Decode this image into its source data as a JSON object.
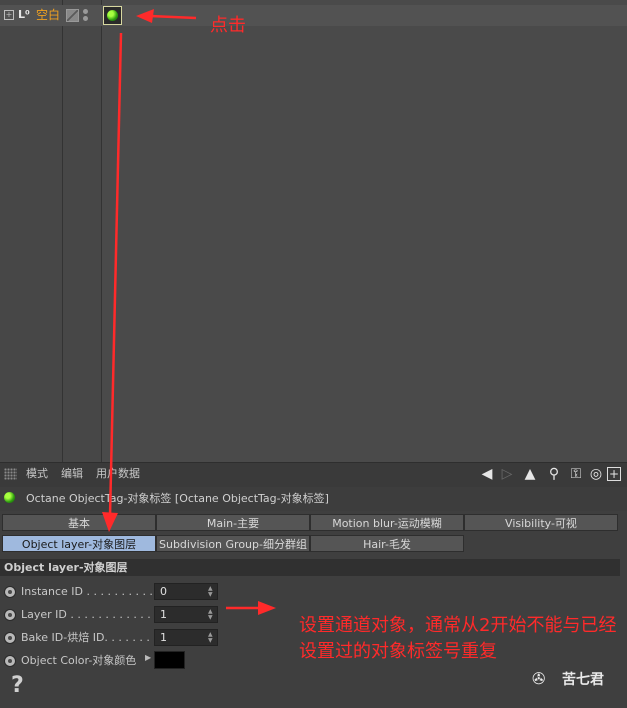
{
  "object_manager": {
    "object_name": "空白",
    "null_icon": "L⁰",
    "tag_icon": "octane-object-tag-icon"
  },
  "attribute_manager": {
    "menu": {
      "mode": "模式",
      "edit": "编辑",
      "user_data": "用户数据"
    },
    "toolbar_icons": [
      "back-arrow-icon",
      "forward-arrow-icon",
      "up-arrow-icon",
      "search-icon",
      "lock-icon",
      "target-icon",
      "new-window-icon"
    ],
    "tag_title": "Octane ObjectTag-对象标签 [Octane ObjectTag-对象标签]",
    "tabs_row1": [
      "基本",
      "Main-主要",
      "Motion blur-运动模糊",
      "Visibility-可视"
    ],
    "tabs_row2": [
      "Object layer-对象图层",
      "Subdivision Group-细分群组",
      "Hair-毛发"
    ],
    "active_tab": "Object layer-对象图层",
    "section_title": "Object layer-对象图层",
    "fields": [
      {
        "label": "Instance ID . . . . . . . . . . .",
        "value": "0"
      },
      {
        "label": "Layer ID . . . . . . . . . . . . . .",
        "value": "1"
      },
      {
        "label": "Bake ID-烘焙 ID. . . . . . . .",
        "value": "1"
      },
      {
        "label": "Object Color-对象颜色",
        "value": ""
      }
    ],
    "object_color": "#000000"
  },
  "annotations": {
    "click_label": "点击",
    "note": "设置通道对象，通常从2开始不能与已经设置过的对象标签号重复",
    "color": "#ff2a2a"
  },
  "watermark": {
    "text": "苦七君"
  }
}
